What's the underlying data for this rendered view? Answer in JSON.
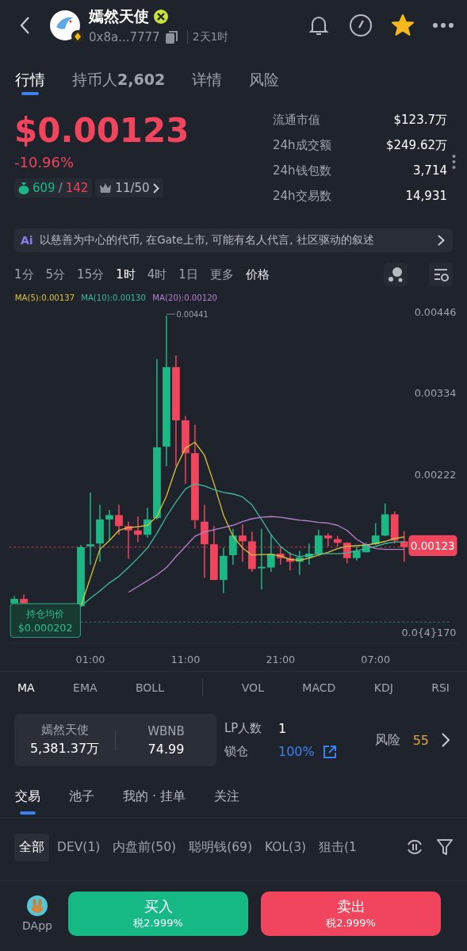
{
  "header": {
    "title": "嫣然天使",
    "address": "0x8a...7777",
    "age": "2天1时",
    "favorite": true
  },
  "tabs": [
    {
      "label": "行情",
      "selected": true
    },
    {
      "label": "持币人",
      "count": "2,602",
      "selected": false
    },
    {
      "label": "详情",
      "selected": false
    },
    {
      "label": "风险",
      "selected": false
    }
  ],
  "price": {
    "value": "$0.00123",
    "change": "-10.96%"
  },
  "badges": {
    "buys": "609",
    "separator": "/",
    "sells": "142",
    "top_holders": "11/50"
  },
  "stats": [
    {
      "label": "流通市值",
      "value": "$123.7万"
    },
    {
      "label": "24h成交额",
      "value": "$249.62万"
    },
    {
      "label": "24h钱包数",
      "value": "3,714"
    },
    {
      "label": "24h交易数",
      "value": "14,931"
    }
  ],
  "ai_summary": {
    "tag": "Ai",
    "text": "以慈善为中心的代币, 在Gate上市, 可能有名人代言, 社区驱动的叙述"
  },
  "intervals": [
    {
      "label": "1分",
      "selected": false
    },
    {
      "label": "5分",
      "selected": false
    },
    {
      "label": "15分",
      "selected": false
    },
    {
      "label": "1时",
      "selected": true
    },
    {
      "label": "4时",
      "selected": false
    },
    {
      "label": "1日",
      "selected": false
    },
    {
      "label": "更多",
      "selected": false
    }
  ],
  "price_mode": "价格",
  "chart": {
    "chart_data": {
      "type": "candlestick",
      "categories": [
        null,
        null,
        null,
        null,
        null,
        null,
        null,
        null,
        "01:00",
        null,
        null,
        null,
        null,
        null,
        null,
        null,
        null,
        null,
        "11:00",
        null,
        null,
        null,
        null,
        null,
        null,
        null,
        null,
        null,
        "21:00",
        null,
        null,
        null,
        null,
        null,
        null,
        null,
        null,
        null,
        "07:00",
        null,
        null,
        null
      ],
      "ohlc": [
        [
          0.00046,
          0.00056,
          0.00045,
          0.00052
        ],
        [
          0.00052,
          0.00058,
          0.00045,
          0.00046
        ],
        null,
        null,
        null,
        null,
        null,
        [
          0.00042,
          0.00126,
          0.00041,
          0.00123
        ],
        [
          0.00124,
          0.00198,
          0.00099,
          0.00127
        ],
        [
          0.00128,
          0.00181,
          0.00103,
          0.00161
        ],
        [
          0.00161,
          0.00174,
          0.00132,
          0.00167
        ],
        [
          0.00167,
          0.00181,
          0.0014,
          0.00152
        ],
        [
          0.00152,
          0.00158,
          0.00107,
          0.00146
        ],
        [
          0.00146,
          0.00165,
          0.0013,
          0.0014
        ],
        [
          0.0014,
          0.00177,
          0.00136,
          0.00161
        ],
        [
          0.00163,
          0.00381,
          0.00161,
          0.0026
        ],
        [
          0.00261,
          0.00441,
          0.00234,
          0.0037
        ],
        [
          0.0037,
          0.00386,
          0.00234,
          0.00297
        ],
        [
          0.00297,
          0.00303,
          0.0021,
          0.00252
        ],
        [
          0.00252,
          0.00291,
          0.00148,
          0.0016
        ],
        [
          0.00158,
          0.00181,
          0.00081,
          0.00127
        ],
        [
          0.00127,
          0.00152,
          0.00078,
          0.00078
        ],
        [
          0.00078,
          0.00122,
          0.0006,
          0.00111
        ],
        [
          0.00112,
          0.00148,
          0.00099,
          0.00139
        ],
        [
          0.00139,
          0.00154,
          0.00103,
          0.00131
        ],
        [
          0.00131,
          0.00144,
          0.00089,
          0.00093
        ],
        [
          0.00094,
          0.00148,
          0.00065,
          0.00096
        ],
        [
          0.00095,
          0.0014,
          0.00089,
          0.00114
        ],
        [
          0.00114,
          0.00124,
          0.00099,
          0.00108
        ],
        [
          0.00108,
          0.00116,
          0.00091,
          0.00103
        ],
        [
          0.00103,
          0.00118,
          0.00085,
          0.00109
        ],
        [
          0.00109,
          0.00128,
          0.00099,
          0.00114
        ],
        [
          0.00114,
          0.00147,
          0.00112,
          0.00139
        ],
        [
          0.00139,
          0.00142,
          0.00124,
          0.00135
        ],
        [
          0.00134,
          0.00139,
          0.00124,
          0.00129
        ],
        [
          0.00129,
          0.0013,
          0.00101,
          0.00108
        ],
        [
          0.00108,
          0.00124,
          0.00105,
          0.00118
        ],
        [
          0.00116,
          0.00129,
          0.00116,
          0.00127
        ],
        [
          0.00127,
          0.00156,
          0.00126,
          0.00139
        ],
        [
          0.00139,
          0.00183,
          0.00138,
          0.00168
        ],
        [
          0.00168,
          0.00172,
          0.00128,
          0.00132
        ],
        [
          0.00131,
          0.00145,
          0.00103,
          0.00123
        ]
      ],
      "series": [
        {
          "name": "MA(5):0.00137",
          "type": "line",
          "color": "#d9c33a",
          "values": [
            null,
            null,
            null,
            null,
            null,
            null,
            null,
            0.00042,
            0.00081,
            0.0012,
            0.00132,
            0.00146,
            0.0015,
            0.00151,
            0.00153,
            0.00165,
            0.00193,
            0.00232,
            0.00259,
            0.00267,
            0.00249,
            0.0021,
            0.00167,
            0.00138,
            0.00122,
            0.00112,
            0.00113,
            0.00113,
            0.00111,
            0.00106,
            0.00105,
            0.00108,
            0.00112,
            0.00116,
            0.00121,
            0.00124,
            0.00125,
            0.00126,
            0.00128,
            0.00131,
            0.00135,
            0.00137
          ]
        },
        {
          "name": "MA(10):0.00130",
          "type": "line",
          "color": "#3db89c",
          "values": [
            null,
            null,
            null,
            null,
            null,
            null,
            null,
            0.00042,
            0.00053,
            0.00063,
            0.00074,
            0.00083,
            0.00095,
            0.00108,
            0.00122,
            0.00142,
            0.00165,
            0.00185,
            0.00203,
            0.0021,
            0.00207,
            0.00202,
            0.00198,
            0.00196,
            0.00192,
            0.00181,
            0.00161,
            0.0014,
            0.00124,
            0.00114,
            0.0011,
            0.00112,
            0.00114,
            0.00114,
            0.00114,
            0.00115,
            0.00118,
            0.00121,
            0.00124,
            0.00128,
            0.0013,
            0.0013
          ]
        },
        {
          "name": "MA(20):0.00120",
          "type": "line",
          "color": "#b780d2",
          "values": [
            null,
            null,
            null,
            null,
            null,
            null,
            null,
            null,
            null,
            null,
            null,
            null,
            0.00061,
            0.00069,
            0.00077,
            0.00085,
            0.00095,
            0.0011,
            0.00124,
            0.00138,
            0.00144,
            0.00147,
            0.0015,
            0.00153,
            0.00158,
            0.00162,
            0.00164,
            0.00165,
            0.00164,
            0.00162,
            0.0016,
            0.00159,
            0.00157,
            0.00156,
            0.00153,
            0.00146,
            0.00134,
            0.00126,
            0.00121,
            0.0012,
            0.0012,
            0.0012
          ]
        }
      ],
      "ylim": [
        1.7e-05,
        0.00446
      ],
      "ref_lines": [
        {
          "axis": "y",
          "value": 0.00123,
          "color": "#f0455c"
        },
        {
          "axis": "y",
          "value": 0.000202,
          "color": "#2c9a7c"
        }
      ],
      "yticks": [
        0.00446,
        0.00334,
        0.00222,
        {
          "value": 1.7e-05,
          "label": "0.0{4}170"
        }
      ]
    },
    "high_label": "0.00441",
    "last_price": "0.00123",
    "avg_cost": {
      "label": "持仓均价",
      "value": "$0.000202"
    }
  },
  "indicators": [
    {
      "label": "MA",
      "selected": true,
      "divider_before": false
    },
    {
      "label": "EMA",
      "selected": false,
      "divider_before": false
    },
    {
      "label": "BOLL",
      "selected": false,
      "divider_before": false
    },
    {
      "label": "VOL",
      "selected": false,
      "divider_before": true
    },
    {
      "label": "MACD",
      "selected": false,
      "divider_before": false
    },
    {
      "label": "KDJ",
      "selected": false,
      "divider_before": false
    },
    {
      "label": "RSI",
      "selected": false,
      "divider_before": false
    }
  ],
  "liquidity": {
    "pair": [
      {
        "token": "嫣然天使",
        "amount": "5,381.37万"
      },
      {
        "token": "WBNB",
        "amount": "74.99"
      }
    ],
    "lp_label": "LP人数",
    "lp_count": "1",
    "lock_label": "锁仓",
    "lock_value": "100%",
    "risk_label": "风险",
    "risk_score": "55"
  },
  "sub_tabs": [
    {
      "label": "交易",
      "selected": true
    },
    {
      "label": "池子",
      "selected": false
    },
    {
      "label": "我的 · 挂单",
      "selected": false
    },
    {
      "label": "关注",
      "selected": false
    }
  ],
  "filters": [
    {
      "label": "全部",
      "selected": true
    },
    {
      "label": "DEV(1)",
      "selected": false
    },
    {
      "label": "内盘前(50)",
      "selected": false
    },
    {
      "label": "聪明钱(69)",
      "selected": false
    },
    {
      "label": "KOL(3)",
      "selected": false
    },
    {
      "label": "狙击(1",
      "selected": false
    }
  ],
  "actions": {
    "dapp": "DApp",
    "buy": {
      "label": "买入",
      "tax": "税2.999%"
    },
    "sell": {
      "label": "卖出",
      "tax": "税2.999%"
    }
  }
}
